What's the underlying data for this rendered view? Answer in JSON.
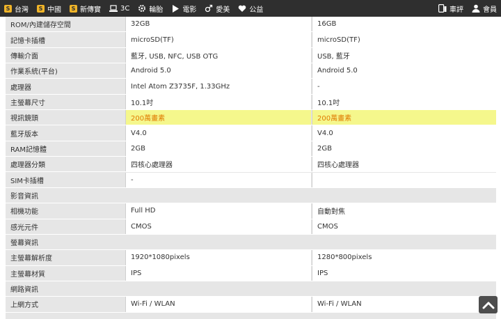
{
  "topbar": {
    "left_items": [
      {
        "label": "台灣",
        "icon": "s-badge-icon",
        "badge": "S"
      },
      {
        "label": "中國",
        "icon": "s-badge-icon",
        "badge": "S"
      },
      {
        "label": "新傳實",
        "icon": "s-badge-icon",
        "badge": "S"
      },
      {
        "label": "3C",
        "icon": "laptop-icon"
      },
      {
        "label": "輪胎",
        "icon": "gear-icon"
      },
      {
        "label": "電影",
        "icon": "play-icon"
      },
      {
        "label": "愛美",
        "icon": "gender-icon"
      },
      {
        "label": "公益",
        "icon": "heart-icon"
      }
    ],
    "right_items": [
      {
        "label": "車評",
        "icon": "device-icon"
      },
      {
        "label": "會員",
        "icon": "user-icon"
      }
    ]
  },
  "table": {
    "rows": [
      {
        "label": "ROM/內建儲存空間",
        "v1": "32GB",
        "v2": "16GB"
      },
      {
        "label": "記憶卡插槽",
        "v1": "microSD(TF)",
        "v2": "microSD(TF)"
      },
      {
        "label": "傳輸介面",
        "v1": "藍牙, USB, NFC, USB OTG",
        "v2": "USB, 藍牙"
      },
      {
        "label": "作業系統(平台)",
        "v1": "Android 5.0",
        "v2": "Android 5.0"
      },
      {
        "label": "處理器",
        "v1": "Intel Atom Z3735F, 1.33GHz",
        "v2": "-"
      },
      {
        "label": "主螢幕尺寸",
        "v1": "10.1吋",
        "v2": "10.1吋"
      },
      {
        "label": "視訊鏡頭",
        "v1": "200萬畫素",
        "v2": "200萬畫素",
        "highlight": true
      },
      {
        "label": "藍牙版本",
        "v1": "V4.0",
        "v2": "V4.0"
      },
      {
        "label": "RAM記憶體",
        "v1": "2GB",
        "v2": "2GB"
      },
      {
        "label": "處理器分類",
        "v1": "四核心處理器",
        "v2": "四核心處理器"
      },
      {
        "label": "SIM卡插槽",
        "v1": "-",
        "v2": ""
      },
      {
        "label": "影音資訊",
        "section": true
      },
      {
        "label": "相機功能",
        "v1": "Full HD",
        "v2": "自動對焦"
      },
      {
        "label": "感光元件",
        "v1": "CMOS",
        "v2": "CMOS"
      },
      {
        "label": "螢幕資訊",
        "section": true
      },
      {
        "label": "主螢幕解析度",
        "v1": "1920*1080pixels",
        "v2": "1280*800pixels"
      },
      {
        "label": "主螢幕材質",
        "v1": "IPS",
        "v2": "IPS"
      },
      {
        "label": "網路資訊",
        "section": true
      },
      {
        "label": "上網方式",
        "v1": "Wi-Fi / WLAN",
        "v2": "Wi-Fi / WLAN"
      }
    ]
  },
  "colors": {
    "topbar_bg": "#2f2f2f",
    "label_bg": "#e6e6e6",
    "highlight_bg": "#f5f78c",
    "highlight_text": "#e07a00",
    "badge": "#f0b428"
  },
  "scroll_top": {
    "icon": "chevron-up-icon"
  }
}
